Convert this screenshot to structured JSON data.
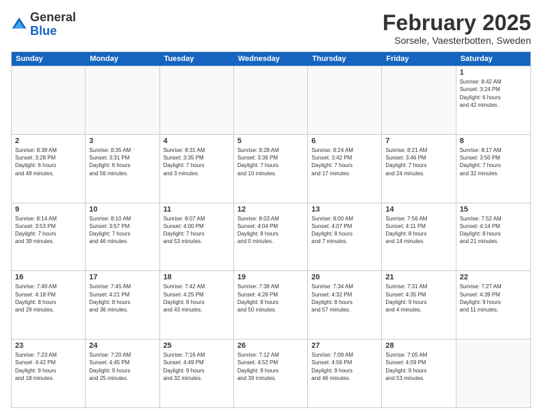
{
  "logo": {
    "general": "General",
    "blue": "Blue"
  },
  "header": {
    "month": "February 2025",
    "location": "Sorsele, Vaesterbotten, Sweden"
  },
  "weekdays": [
    "Sunday",
    "Monday",
    "Tuesday",
    "Wednesday",
    "Thursday",
    "Friday",
    "Saturday"
  ],
  "weeks": [
    [
      {
        "day": "",
        "info": ""
      },
      {
        "day": "",
        "info": ""
      },
      {
        "day": "",
        "info": ""
      },
      {
        "day": "",
        "info": ""
      },
      {
        "day": "",
        "info": ""
      },
      {
        "day": "",
        "info": ""
      },
      {
        "day": "1",
        "info": "Sunrise: 8:42 AM\nSunset: 3:24 PM\nDaylight: 6 hours\nand 42 minutes."
      }
    ],
    [
      {
        "day": "2",
        "info": "Sunrise: 8:38 AM\nSunset: 3:28 PM\nDaylight: 6 hours\nand 49 minutes."
      },
      {
        "day": "3",
        "info": "Sunrise: 8:35 AM\nSunset: 3:31 PM\nDaylight: 6 hours\nand 56 minutes."
      },
      {
        "day": "4",
        "info": "Sunrise: 8:31 AM\nSunset: 3:35 PM\nDaylight: 7 hours\nand 3 minutes."
      },
      {
        "day": "5",
        "info": "Sunrise: 8:28 AM\nSunset: 3:39 PM\nDaylight: 7 hours\nand 10 minutes."
      },
      {
        "day": "6",
        "info": "Sunrise: 8:24 AM\nSunset: 3:42 PM\nDaylight: 7 hours\nand 17 minutes."
      },
      {
        "day": "7",
        "info": "Sunrise: 8:21 AM\nSunset: 3:46 PM\nDaylight: 7 hours\nand 24 minutes."
      },
      {
        "day": "8",
        "info": "Sunrise: 8:17 AM\nSunset: 3:50 PM\nDaylight: 7 hours\nand 32 minutes."
      }
    ],
    [
      {
        "day": "9",
        "info": "Sunrise: 8:14 AM\nSunset: 3:53 PM\nDaylight: 7 hours\nand 39 minutes."
      },
      {
        "day": "10",
        "info": "Sunrise: 8:10 AM\nSunset: 3:57 PM\nDaylight: 7 hours\nand 46 minutes."
      },
      {
        "day": "11",
        "info": "Sunrise: 8:07 AM\nSunset: 4:00 PM\nDaylight: 7 hours\nand 53 minutes."
      },
      {
        "day": "12",
        "info": "Sunrise: 8:03 AM\nSunset: 4:04 PM\nDaylight: 8 hours\nand 0 minutes."
      },
      {
        "day": "13",
        "info": "Sunrise: 8:00 AM\nSunset: 4:07 PM\nDaylight: 8 hours\nand 7 minutes."
      },
      {
        "day": "14",
        "info": "Sunrise: 7:56 AM\nSunset: 4:11 PM\nDaylight: 8 hours\nand 14 minutes."
      },
      {
        "day": "15",
        "info": "Sunrise: 7:52 AM\nSunset: 4:14 PM\nDaylight: 8 hours\nand 21 minutes."
      }
    ],
    [
      {
        "day": "16",
        "info": "Sunrise: 7:49 AM\nSunset: 4:18 PM\nDaylight: 8 hours\nand 29 minutes."
      },
      {
        "day": "17",
        "info": "Sunrise: 7:45 AM\nSunset: 4:21 PM\nDaylight: 8 hours\nand 36 minutes."
      },
      {
        "day": "18",
        "info": "Sunrise: 7:42 AM\nSunset: 4:25 PM\nDaylight: 8 hours\nand 43 minutes."
      },
      {
        "day": "19",
        "info": "Sunrise: 7:38 AM\nSunset: 4:28 PM\nDaylight: 8 hours\nand 50 minutes."
      },
      {
        "day": "20",
        "info": "Sunrise: 7:34 AM\nSunset: 4:32 PM\nDaylight: 8 hours\nand 57 minutes."
      },
      {
        "day": "21",
        "info": "Sunrise: 7:31 AM\nSunset: 4:35 PM\nDaylight: 9 hours\nand 4 minutes."
      },
      {
        "day": "22",
        "info": "Sunrise: 7:27 AM\nSunset: 4:39 PM\nDaylight: 9 hours\nand 11 minutes."
      }
    ],
    [
      {
        "day": "23",
        "info": "Sunrise: 7:23 AM\nSunset: 4:42 PM\nDaylight: 9 hours\nand 18 minutes."
      },
      {
        "day": "24",
        "info": "Sunrise: 7:20 AM\nSunset: 4:45 PM\nDaylight: 9 hours\nand 25 minutes."
      },
      {
        "day": "25",
        "info": "Sunrise: 7:16 AM\nSunset: 4:49 PM\nDaylight: 9 hours\nand 32 minutes."
      },
      {
        "day": "26",
        "info": "Sunrise: 7:12 AM\nSunset: 4:52 PM\nDaylight: 9 hours\nand 39 minutes."
      },
      {
        "day": "27",
        "info": "Sunrise: 7:09 AM\nSunset: 4:56 PM\nDaylight: 9 hours\nand 46 minutes."
      },
      {
        "day": "28",
        "info": "Sunrise: 7:05 AM\nSunset: 4:59 PM\nDaylight: 9 hours\nand 53 minutes."
      },
      {
        "day": "",
        "info": ""
      }
    ]
  ]
}
